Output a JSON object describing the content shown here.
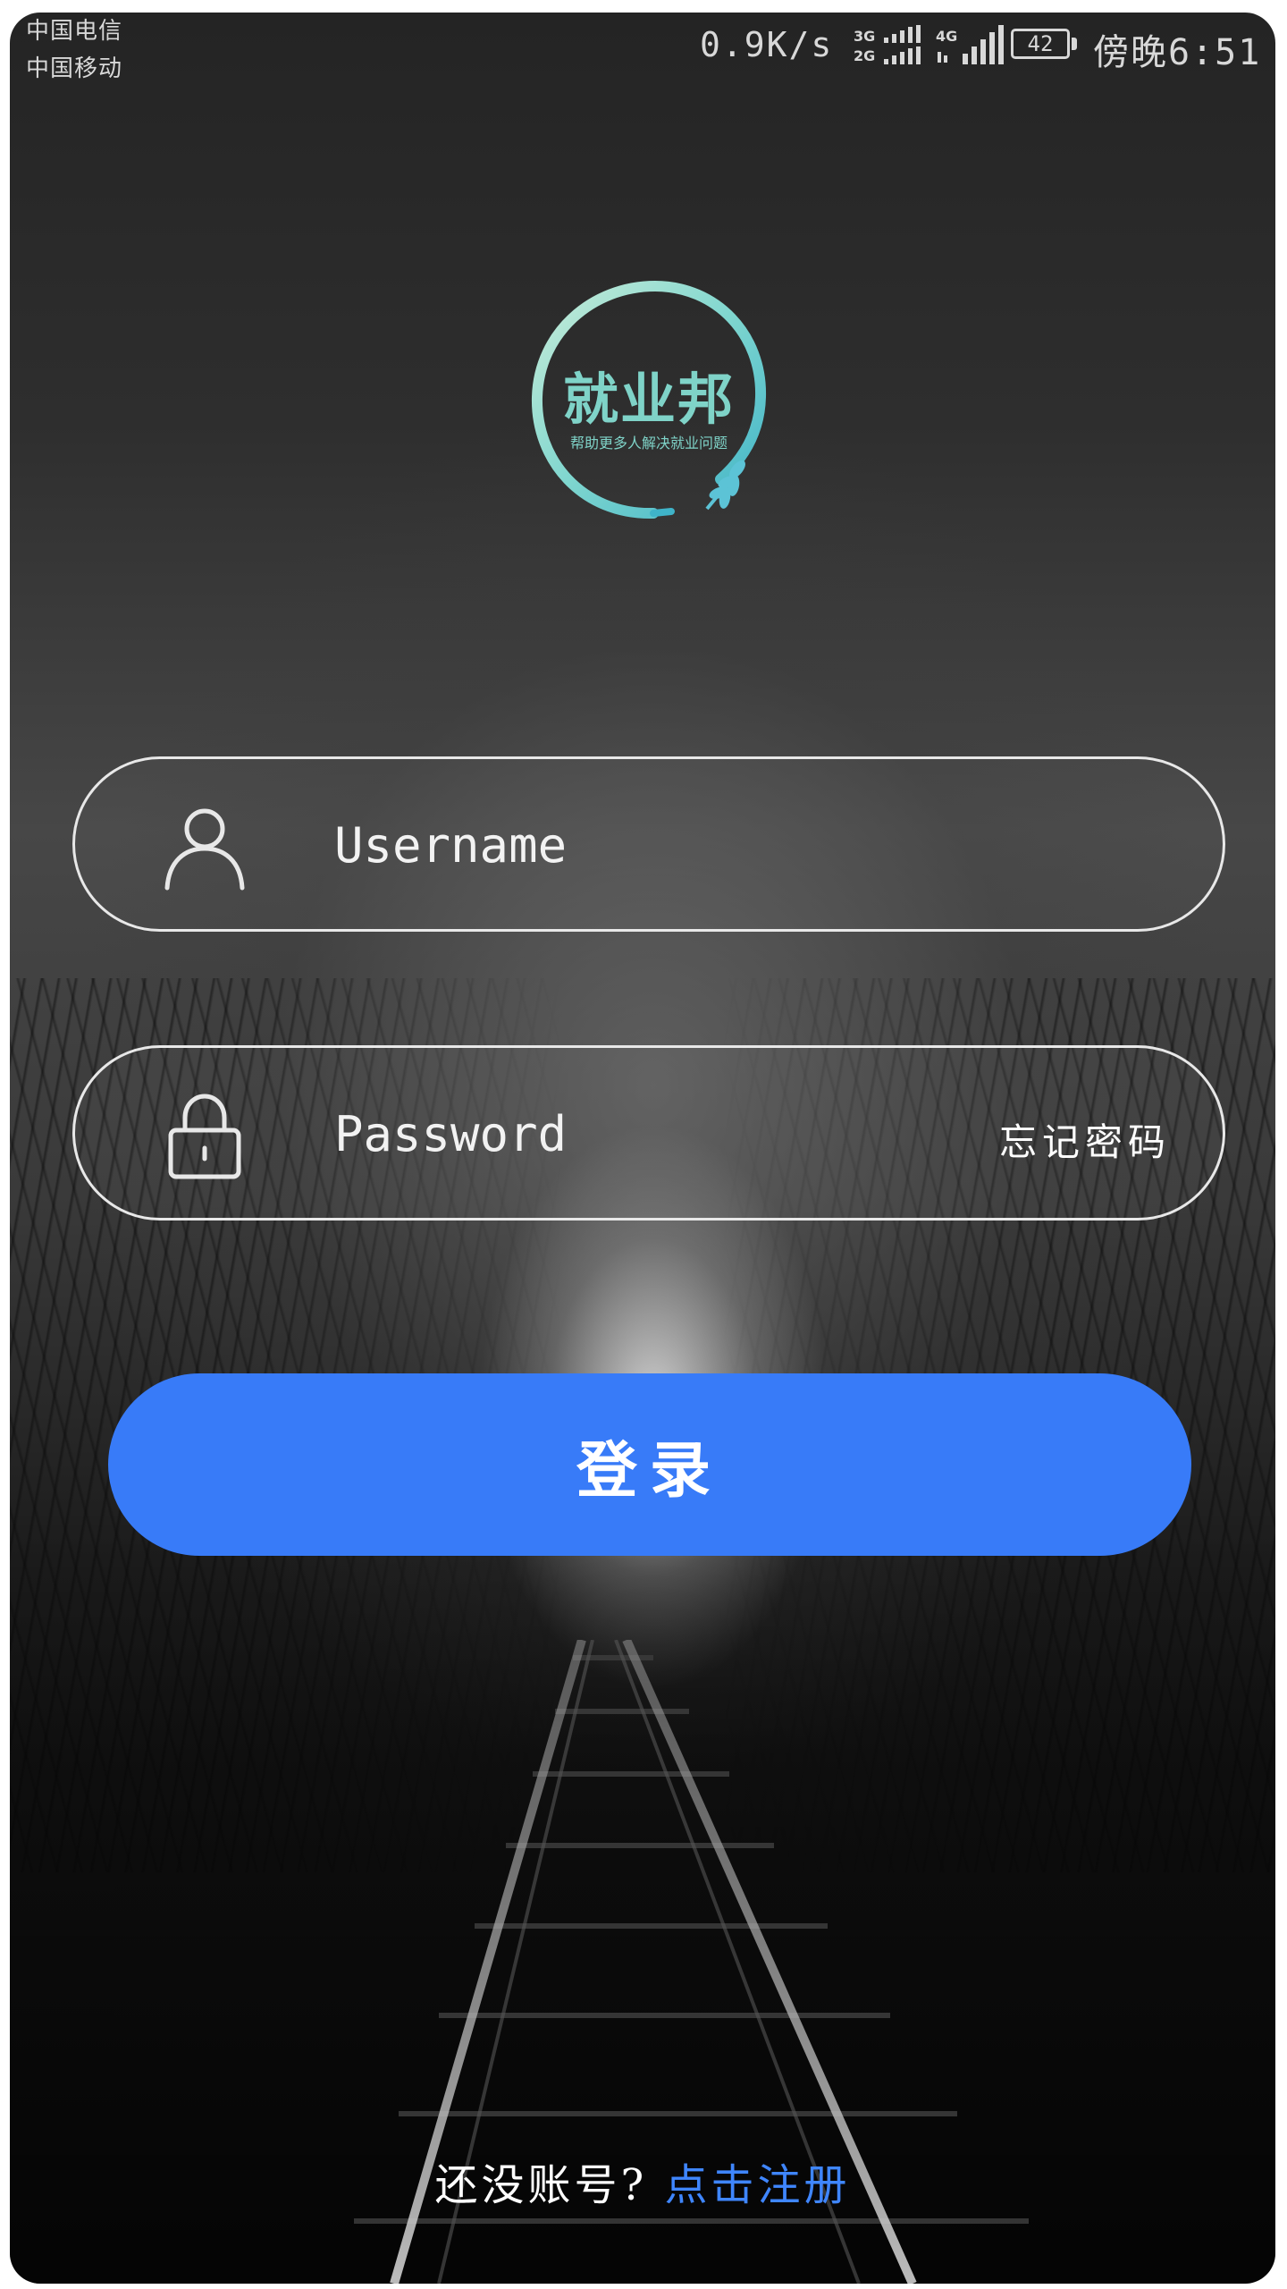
{
  "status_bar": {
    "carrier_1": "中国电信",
    "carrier_2": "中国移动",
    "net_speed": "0.9K/s",
    "signal_1_label_top": "3G",
    "signal_1_label_bottom": "2G",
    "signal_2_label": "4G",
    "battery_level": "42",
    "time": "傍晚6:51"
  },
  "logo": {
    "title": "就业邦",
    "subtitle": "帮助更多人解决就业问题"
  },
  "form": {
    "username_placeholder": "Username",
    "password_placeholder": "Password",
    "forgot_password": "忘记密码",
    "login_label": "登录"
  },
  "footer": {
    "register_prompt": "还没账号?",
    "register_link": "点击注册"
  },
  "colors": {
    "accent_blue": "#387bf8",
    "link_blue": "#3f86ff",
    "logo_teal": "#7fd3c8"
  }
}
